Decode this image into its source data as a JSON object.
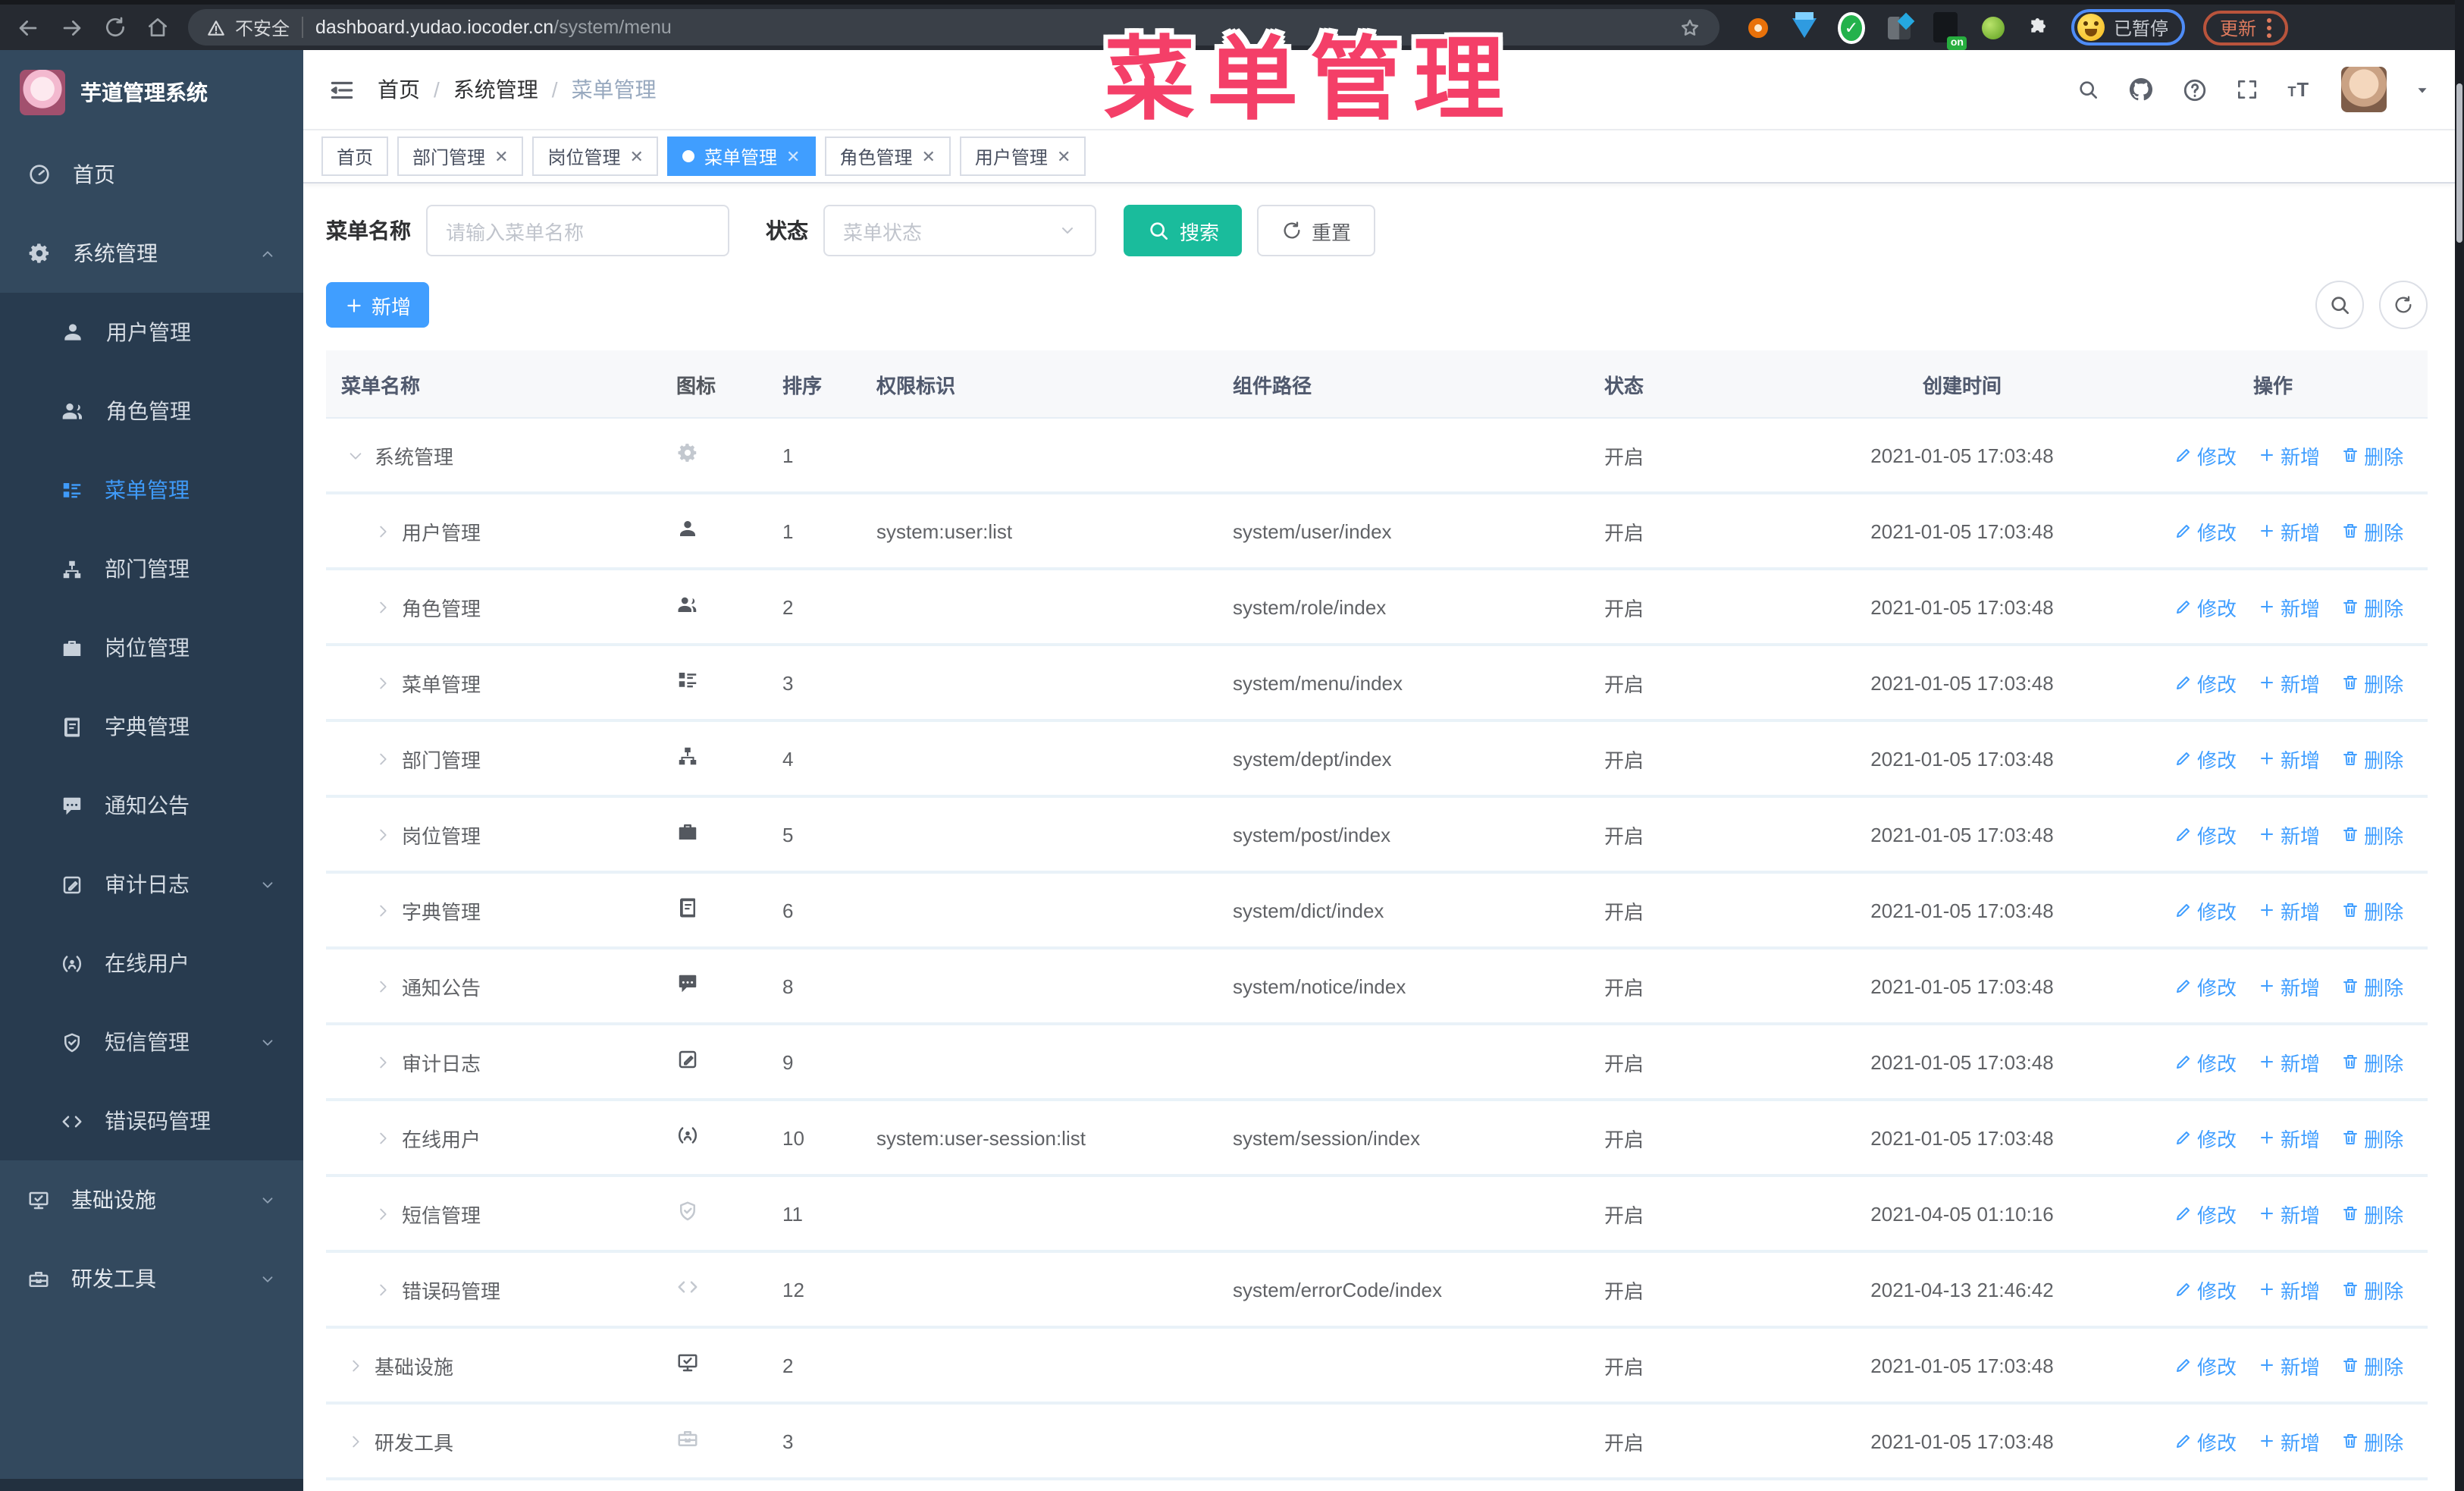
{
  "browser": {
    "security_label": "不安全",
    "url_host": "dashboard.yudao.iocoder.cn",
    "url_path": "/system/menu",
    "ext_on_label": "on",
    "paused_label": "已暂停",
    "update_label": "更新",
    "nav_icons": [
      "back-icon",
      "forward-icon",
      "reload-icon",
      "home-icon"
    ],
    "extensions": [
      "ext-orange-ring",
      "ext-blue-gem",
      "ext-green-check",
      "ext-grid",
      "ext-dark-on",
      "ext-green-key",
      "ext-puzzle"
    ]
  },
  "overlay": {
    "title": "菜单管理"
  },
  "sidebar": {
    "logo_title": "芋道管理系统",
    "items": [
      {
        "label": "首页",
        "icon": "dashboard-icon",
        "type": "top"
      },
      {
        "label": "系统管理",
        "icon": "gear-icon",
        "type": "top",
        "arrow": "up"
      },
      {
        "label": "用户管理",
        "icon": "user-icon",
        "type": "sub"
      },
      {
        "label": "角色管理",
        "icon": "users-icon",
        "type": "sub"
      },
      {
        "label": "菜单管理",
        "icon": "menu-tree-icon",
        "type": "sub",
        "active": true
      },
      {
        "label": "部门管理",
        "icon": "org-tree-icon",
        "type": "sub"
      },
      {
        "label": "岗位管理",
        "icon": "briefcase-icon",
        "type": "sub"
      },
      {
        "label": "字典管理",
        "icon": "dict-icon",
        "type": "sub"
      },
      {
        "label": "通知公告",
        "icon": "notice-icon",
        "type": "sub"
      },
      {
        "label": "审计日志",
        "icon": "audit-icon",
        "type": "sub",
        "arrow": "down"
      },
      {
        "label": "在线用户",
        "icon": "online-icon",
        "type": "sub"
      },
      {
        "label": "短信管理",
        "icon": "shield-check-icon",
        "type": "sub",
        "arrow": "down"
      },
      {
        "label": "错误码管理",
        "icon": "code-icon",
        "type": "sub"
      },
      {
        "label": "基础设施",
        "icon": "monitor-icon",
        "type": "top",
        "arrow": "down"
      },
      {
        "label": "研发工具",
        "icon": "toolbox-icon",
        "type": "top",
        "arrow": "down"
      }
    ]
  },
  "header": {
    "breadcrumb": [
      "首页",
      "系统管理",
      "菜单管理"
    ],
    "right_icons": [
      "search-icon",
      "github-icon",
      "question-icon",
      "fullscreen-icon",
      "font-size-icon"
    ]
  },
  "tags": [
    {
      "label": "首页",
      "closable": false,
      "active": false
    },
    {
      "label": "部门管理",
      "closable": true,
      "active": false
    },
    {
      "label": "岗位管理",
      "closable": true,
      "active": false
    },
    {
      "label": "菜单管理",
      "closable": true,
      "active": true
    },
    {
      "label": "角色管理",
      "closable": true,
      "active": false
    },
    {
      "label": "用户管理",
      "closable": true,
      "active": false
    }
  ],
  "filters": {
    "name_label": "菜单名称",
    "name_placeholder": "请输入菜单名称",
    "status_label": "状态",
    "status_placeholder": "菜单状态",
    "search_label": "搜索",
    "reset_label": "重置"
  },
  "toolbar": {
    "add_label": "新增"
  },
  "colors": {
    "primary": "#409EFF",
    "search_teal": "#1ABC9C",
    "overlay_pink": "#F43F68"
  },
  "table": {
    "columns": [
      "菜单名称",
      "图标",
      "排序",
      "权限标识",
      "组件路径",
      "状态",
      "创建时间",
      "操作"
    ],
    "actions": {
      "edit": "修改",
      "add": "新增",
      "delete": "删除"
    },
    "rows": [
      {
        "name": "系统管理",
        "level": 1,
        "expanded": true,
        "icon": "gear-icon",
        "muted": true,
        "order": "1",
        "perm": "",
        "path": "",
        "status": "开启",
        "time": "2021-01-05 17:03:48"
      },
      {
        "name": "用户管理",
        "level": 2,
        "expanded": false,
        "icon": "user-icon",
        "muted": false,
        "order": "1",
        "perm": "system:user:list",
        "path": "system/user/index",
        "status": "开启",
        "time": "2021-01-05 17:03:48"
      },
      {
        "name": "角色管理",
        "level": 2,
        "expanded": false,
        "icon": "users-icon",
        "muted": false,
        "order": "2",
        "perm": "",
        "path": "system/role/index",
        "status": "开启",
        "time": "2021-01-05 17:03:48"
      },
      {
        "name": "菜单管理",
        "level": 2,
        "expanded": false,
        "icon": "menu-tree-icon",
        "muted": false,
        "order": "3",
        "perm": "",
        "path": "system/menu/index",
        "status": "开启",
        "time": "2021-01-05 17:03:48"
      },
      {
        "name": "部门管理",
        "level": 2,
        "expanded": false,
        "icon": "org-tree-icon",
        "muted": false,
        "order": "4",
        "perm": "",
        "path": "system/dept/index",
        "status": "开启",
        "time": "2021-01-05 17:03:48"
      },
      {
        "name": "岗位管理",
        "level": 2,
        "expanded": false,
        "icon": "briefcase-icon",
        "muted": false,
        "order": "5",
        "perm": "",
        "path": "system/post/index",
        "status": "开启",
        "time": "2021-01-05 17:03:48"
      },
      {
        "name": "字典管理",
        "level": 2,
        "expanded": false,
        "icon": "dict-icon",
        "muted": false,
        "order": "6",
        "perm": "",
        "path": "system/dict/index",
        "status": "开启",
        "time": "2021-01-05 17:03:48"
      },
      {
        "name": "通知公告",
        "level": 2,
        "expanded": false,
        "icon": "notice-icon",
        "muted": false,
        "order": "8",
        "perm": "",
        "path": "system/notice/index",
        "status": "开启",
        "time": "2021-01-05 17:03:48"
      },
      {
        "name": "审计日志",
        "level": 2,
        "expanded": false,
        "icon": "audit-icon",
        "muted": false,
        "order": "9",
        "perm": "",
        "path": "",
        "status": "开启",
        "time": "2021-01-05 17:03:48"
      },
      {
        "name": "在线用户",
        "level": 2,
        "expanded": false,
        "icon": "online-icon",
        "muted": false,
        "order": "10",
        "perm": "system:user-session:list",
        "path": "system/session/index",
        "status": "开启",
        "time": "2021-01-05 17:03:48"
      },
      {
        "name": "短信管理",
        "level": 2,
        "expanded": false,
        "icon": "shield-check-icon",
        "muted": true,
        "order": "11",
        "perm": "",
        "path": "",
        "status": "开启",
        "time": "2021-04-05 01:10:16"
      },
      {
        "name": "错误码管理",
        "level": 2,
        "expanded": false,
        "icon": "code-icon",
        "muted": true,
        "order": "12",
        "perm": "",
        "path": "system/errorCode/index",
        "status": "开启",
        "time": "2021-04-13 21:46:42"
      },
      {
        "name": "基础设施",
        "level": 1,
        "expanded": false,
        "icon": "monitor-icon",
        "muted": false,
        "order": "2",
        "perm": "",
        "path": "",
        "status": "开启",
        "time": "2021-01-05 17:03:48"
      },
      {
        "name": "研发工具",
        "level": 1,
        "expanded": false,
        "icon": "toolbox-icon",
        "muted": true,
        "order": "3",
        "perm": "",
        "path": "",
        "status": "开启",
        "time": "2021-01-05 17:03:48"
      }
    ]
  }
}
